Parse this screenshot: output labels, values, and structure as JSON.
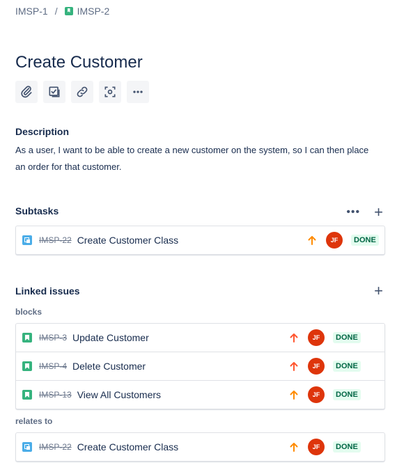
{
  "breadcrumb": {
    "parent": "IMSP-1",
    "separator": "/",
    "current": "IMSP-2"
  },
  "issue": {
    "title": "Create Customer"
  },
  "toolbar": {
    "icons": [
      "paperclip-icon",
      "checklist-icon",
      "link-icon",
      "scan-icon",
      "more-icon"
    ]
  },
  "description": {
    "label": "Description",
    "text": "As a user, I want to be able to create a new customer on the system, so I can then place an order for that customer."
  },
  "subtasks": {
    "label": "Subtasks",
    "more_label": "•••",
    "add_label": "+",
    "items": [
      {
        "key": "IMSP-22",
        "summary": "Create Customer Class",
        "type": "subtask",
        "priority": "medium",
        "assignee": "JF",
        "status": "DONE"
      }
    ]
  },
  "linked": {
    "label": "Linked issues",
    "add_label": "+",
    "groups": [
      {
        "type": "blocks",
        "items": [
          {
            "key": "IMSP-3",
            "summary": "Update Customer",
            "type": "story",
            "priority": "high",
            "assignee": "JF",
            "status": "DONE"
          },
          {
            "key": "IMSP-4",
            "summary": "Delete Customer",
            "type": "story",
            "priority": "high",
            "assignee": "JF",
            "status": "DONE"
          },
          {
            "key": "IMSP-13",
            "summary": "View All Customers",
            "type": "story",
            "priority": "medium",
            "assignee": "JF",
            "status": "DONE"
          }
        ]
      },
      {
        "type": "relates to",
        "items": [
          {
            "key": "IMSP-22",
            "summary": "Create Customer Class",
            "type": "subtask",
            "priority": "medium",
            "assignee": "JF",
            "status": "DONE"
          }
        ]
      }
    ]
  },
  "colors": {
    "priority_high": "#FF5630",
    "priority_medium": "#FF8B00",
    "done_bg": "#E3FCEF",
    "done_text": "#006644",
    "avatar": "#DE350B"
  }
}
